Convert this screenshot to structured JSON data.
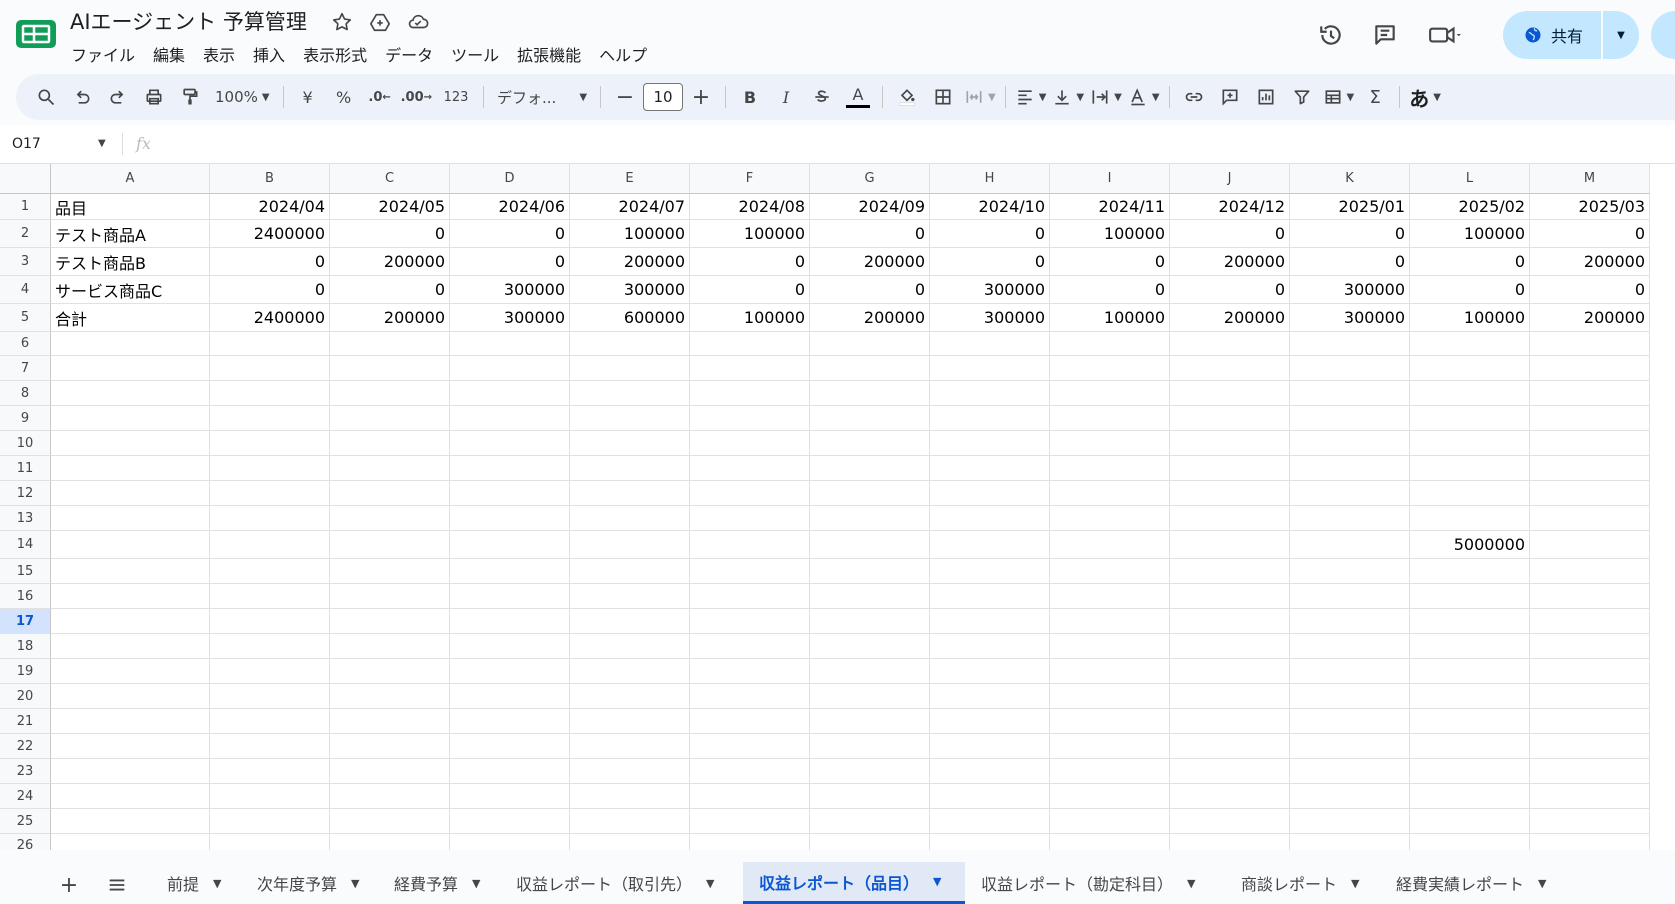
{
  "app": {
    "title": "AIエージェント 予算管理",
    "menu": [
      "ファイル",
      "編集",
      "表示",
      "挿入",
      "表示形式",
      "データ",
      "ツール",
      "拡張機能",
      "ヘルプ"
    ],
    "share_label": "共有",
    "brand_color": "#0f9d58",
    "accent_color": "#0b57d0"
  },
  "toolbar": {
    "zoom": "100%",
    "currency": "¥",
    "percent": "%",
    "format_123": "123",
    "font": "デフォ...",
    "font_size": "10",
    "bold": "B",
    "italic": "I",
    "text_color_letter": "A",
    "ime": "あ",
    "sum": "Σ",
    "dec_decrease": ".0",
    "dec_increase": ".00"
  },
  "formula_bar": {
    "name_box": "O17",
    "fx": "fx"
  },
  "sheet": {
    "columns": [
      "A",
      "B",
      "C",
      "D",
      "E",
      "F",
      "G",
      "H",
      "I",
      "J",
      "K",
      "L",
      "M"
    ],
    "row_numbers": [
      "1",
      "2",
      "3",
      "4",
      "5",
      "6",
      "7",
      "8",
      "9",
      "10",
      "11",
      "12",
      "13",
      "14",
      "15",
      "16",
      "17",
      "18",
      "19",
      "20",
      "21",
      "22",
      "23",
      "24",
      "25",
      "26"
    ],
    "selected_row": "17",
    "header_row": [
      "品目",
      "2024/04",
      "2024/05",
      "2024/06",
      "2024/07",
      "2024/08",
      "2024/09",
      "2024/10",
      "2024/11",
      "2024/12",
      "2025/01",
      "2025/02",
      "2025/03"
    ],
    "rows": [
      [
        "テスト商品A",
        "2400000",
        "0",
        "0",
        "100000",
        "100000",
        "0",
        "0",
        "100000",
        "0",
        "0",
        "100000",
        "0"
      ],
      [
        "テスト商品B",
        "0",
        "200000",
        "0",
        "200000",
        "0",
        "200000",
        "0",
        "0",
        "200000",
        "0",
        "0",
        "200000"
      ],
      [
        "サービス商品C",
        "0",
        "0",
        "300000",
        "300000",
        "0",
        "0",
        "300000",
        "0",
        "0",
        "300000",
        "0",
        "0"
      ],
      [
        "合計",
        "2400000",
        "200000",
        "300000",
        "600000",
        "100000",
        "200000",
        "300000",
        "100000",
        "200000",
        "300000",
        "100000",
        "200000"
      ]
    ],
    "cell_L14": "5000000"
  },
  "tabs": [
    {
      "label": "前提",
      "active": false
    },
    {
      "label": "次年度予算",
      "active": false
    },
    {
      "label": "経費予算",
      "active": false
    },
    {
      "label": "収益レポート（取引先）",
      "active": false
    },
    {
      "label": "収益レポート（品目）",
      "active": true
    },
    {
      "label": "収益レポート（勘定科目）",
      "active": false
    },
    {
      "label": "商談レポート",
      "active": false
    },
    {
      "label": "経費実績レポート",
      "active": false
    }
  ]
}
